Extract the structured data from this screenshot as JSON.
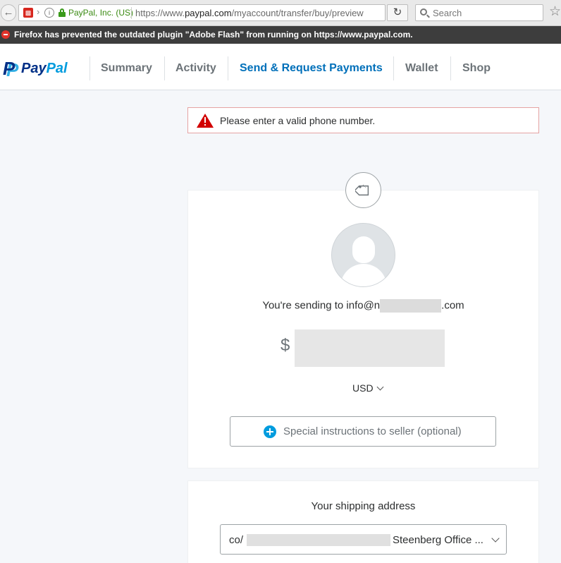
{
  "browser": {
    "identity": "PayPal, Inc. (US)",
    "url_prefix": "https://www.",
    "url_domain": "paypal.com",
    "url_path": "/myaccount/transfer/buy/preview",
    "search_placeholder": "Search",
    "plugin_notice": "Firefox has prevented the outdated plugin \"Adobe Flash\" from running on https://www.paypal.com."
  },
  "nav": {
    "logo_pay": "Pay",
    "logo_pal": "Pal",
    "items": [
      {
        "label": "Summary"
      },
      {
        "label": "Activity"
      },
      {
        "label": "Send & Request Payments"
      },
      {
        "label": "Wallet"
      },
      {
        "label": "Shop"
      }
    ],
    "active": "Send & Request Payments"
  },
  "alert": {
    "message": "Please enter a valid phone number."
  },
  "payment": {
    "sending_prefix": "You're sending to info@n",
    "sending_suffix": ".com",
    "currency_symbol": "$",
    "currency": "USD",
    "instructions_label": "Special instructions to seller (optional)"
  },
  "shipping": {
    "title": "Your shipping address",
    "address_prefix": "co/",
    "address_suffix": "Steenberg Office ..."
  },
  "colors": {
    "accent": "#0070ba",
    "alert_red": "#d20000",
    "plus_blue": "#009cde"
  }
}
